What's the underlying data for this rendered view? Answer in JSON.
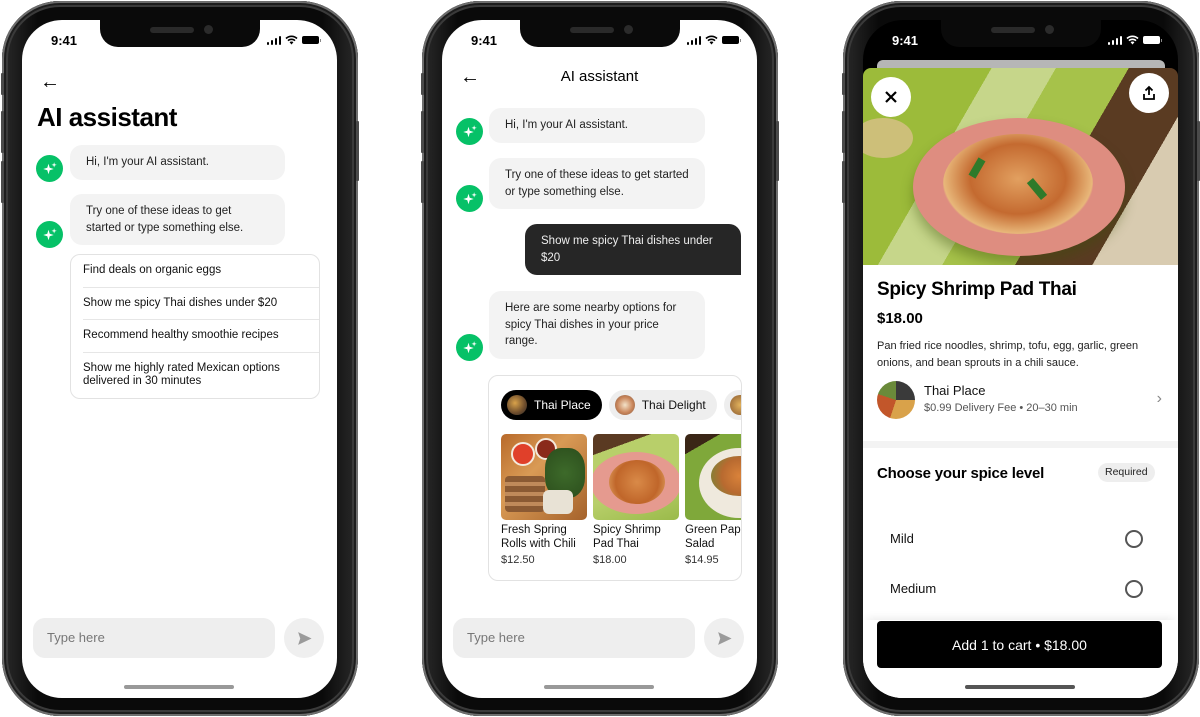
{
  "status_bar": {
    "time": "9:41"
  },
  "screen1": {
    "back_icon": "←",
    "title": "AI assistant",
    "messages": [
      {
        "from": "assistant",
        "text": "Hi, I'm your AI assistant."
      },
      {
        "from": "assistant",
        "text": "Try one of these ideas to get started or type something else."
      }
    ],
    "suggestions": [
      "Find deals on organic eggs",
      "Show me spicy Thai dishes under $20",
      "Recommend healthy smoothie recipes",
      "Show me highly rated Mexican options delivered in 30 minutes"
    ],
    "composer": {
      "placeholder": "Type here"
    }
  },
  "screen2": {
    "back_icon": "←",
    "title": "AI assistant",
    "messages": [
      {
        "from": "assistant",
        "text": "Hi, I'm your AI assistant."
      },
      {
        "from": "assistant",
        "text": "Try one of these ideas to get started or type something else."
      },
      {
        "from": "user",
        "text": "Show me spicy Thai dishes under $20"
      },
      {
        "from": "assistant",
        "text": "Here are some nearby options for spicy Thai dishes in your price range."
      }
    ],
    "restaurant_chips": [
      {
        "label": "Thai Place",
        "active": true
      },
      {
        "label": "Thai Delight",
        "active": false
      },
      {
        "label": "",
        "active": false
      }
    ],
    "dishes": [
      {
        "name_line1": "Fresh Spring",
        "name_line2": "Rolls with Chili",
        "price": "$12.50"
      },
      {
        "name_line1": "Spicy Shrimp",
        "name_line2": "Pad Thai",
        "price": "$18.00"
      },
      {
        "name_line1": "Green Papaya",
        "name_line2": "Salad",
        "price": "$14.95"
      }
    ],
    "composer": {
      "placeholder": "Type here"
    }
  },
  "screen3": {
    "item": {
      "title": "Spicy Shrimp Pad Thai",
      "price": "$18.00",
      "description": "Pan fried rice noodles, shrimp, tofu, egg, garlic, green onions, and bean sprouts in a chili sauce."
    },
    "store": {
      "name": "Thai Place",
      "meta": "$0.99 Delivery Fee • 20–30 min",
      "chevron": "›"
    },
    "spice_section": {
      "title": "Choose your spice level",
      "badge": "Required",
      "options": [
        "Mild",
        "Medium"
      ]
    },
    "cart_button": "Add 1 to cart • $18.00"
  },
  "colors": {
    "brand_green": "#06c167",
    "bubble_gray": "#f3f3f3",
    "user_bubble": "#262626",
    "cta_black": "#000000"
  }
}
